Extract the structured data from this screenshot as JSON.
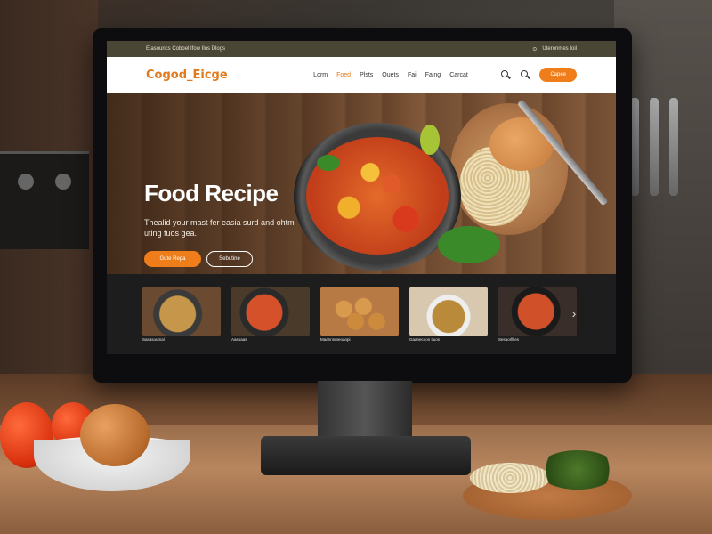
{
  "topbar": {
    "left_text": "Eiasouncs Coboel Ifow Ilos Dlogs",
    "right_text": "Uteronmes Ioil"
  },
  "nav": {
    "logo": "Cogod_Eicge",
    "links": [
      "Lorm",
      "Foed",
      "Plsts",
      "Ouets",
      "Fai",
      "Faing",
      "Carcat"
    ],
    "active_index": 1,
    "cta": "Capee"
  },
  "hero": {
    "title": "Food Recipe",
    "subtitle": "Thealid your mast fer easia surd and ohtm uting fuos gea.",
    "primary_btn": "Gute Repa",
    "secondary_btn": "Sebutine"
  },
  "strip": {
    "cards": [
      {
        "caption": "Sasasoumal",
        "colors": [
          "#6a4a30",
          "#c6964a"
        ]
      },
      {
        "caption": "Aasoaas",
        "colors": [
          "#2a2a2a",
          "#d4512a"
        ]
      },
      {
        "caption": "Maannnmeoanpi",
        "colors": [
          "#b87a44",
          "#d89a4c"
        ]
      },
      {
        "caption": "Gaanecoon tiuos",
        "colors": [
          "#d8c8b0",
          "#b98a3a"
        ]
      },
      {
        "caption": "Sesaorlllles",
        "colors": [
          "#3a2e2a",
          "#d0502a"
        ]
      }
    ],
    "next_icon": "›"
  },
  "colors": {
    "accent": "#ef7d1a",
    "topbar": "#4a4636",
    "strip_bg": "#1d1d1d"
  }
}
